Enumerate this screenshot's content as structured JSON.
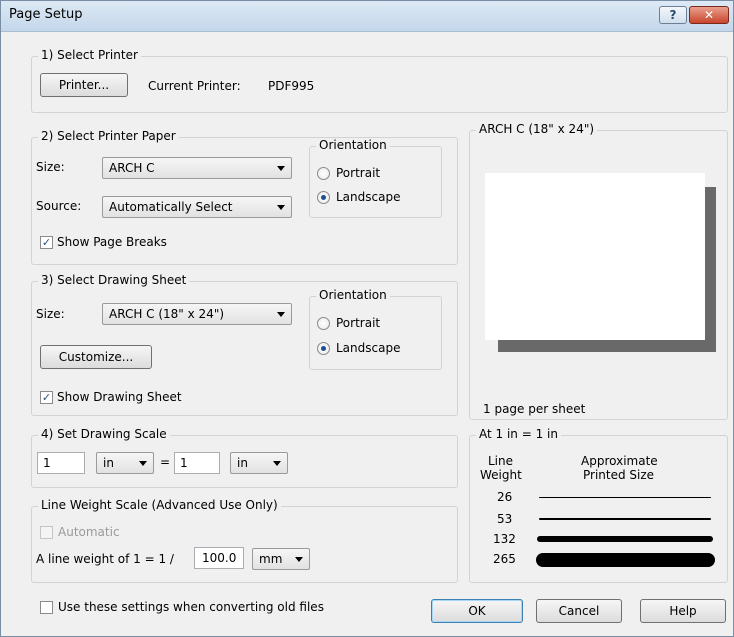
{
  "window": {
    "title": "Page Setup",
    "help_glyph": "?",
    "close_glyph": "✕"
  },
  "select_printer": {
    "legend": "1) Select Printer",
    "printer_button": "Printer...",
    "current_label": "Current Printer:",
    "current_value": "PDF995"
  },
  "printer_paper": {
    "legend": "2) Select Printer Paper",
    "size_label": "Size:",
    "size_value": "ARCH C",
    "source_label": "Source:",
    "source_value": "Automatically Select",
    "orientation_legend": "Orientation",
    "portrait": "Portrait",
    "landscape": "Landscape",
    "selected_orientation": "Landscape",
    "show_page_breaks": "Show Page Breaks",
    "show_page_breaks_checked": true
  },
  "drawing_sheet": {
    "legend": "3) Select Drawing Sheet",
    "size_label": "Size:",
    "size_value": "ARCH C  (18\" x 24\")",
    "orientation_legend": "Orientation",
    "portrait": "Portrait",
    "landscape": "Landscape",
    "selected_orientation": "Landscape",
    "customize_button": "Customize...",
    "show_drawing_sheet": "Show Drawing Sheet",
    "show_drawing_sheet_checked": true
  },
  "drawing_scale": {
    "legend": "4) Set Drawing Scale",
    "left_value": "1",
    "left_unit": "in",
    "equals": "=",
    "right_value": "1",
    "right_unit": "in"
  },
  "line_weight_scale": {
    "legend": "Line Weight Scale (Advanced Use Only)",
    "automatic": "Automatic",
    "automatic_checked": false,
    "line_weight_label": "A line weight of 1 = 1 /",
    "line_weight_value": "100.0",
    "unit": "mm"
  },
  "preview": {
    "legend": "ARCH C  (18\" x 24\")",
    "pages_text": "1 page per sheet"
  },
  "line_weights": {
    "legend": "At 1 in = 1 in",
    "col1_header_line1": "Line",
    "col1_header_line2": "Weight",
    "col2_header_line1": "Approximate",
    "col2_header_line2": "Printed Size",
    "rows": [
      {
        "weight": "26"
      },
      {
        "weight": "53"
      },
      {
        "weight": "132"
      },
      {
        "weight": "265"
      }
    ]
  },
  "footer": {
    "convert_checkbox": "Use these settings when converting old files",
    "convert_checked": false,
    "ok": "OK",
    "cancel": "Cancel",
    "help": "Help"
  },
  "icons": [
    "help-icon",
    "close-icon",
    "dropdown-arrow-icon",
    "checkmark-icon"
  ]
}
